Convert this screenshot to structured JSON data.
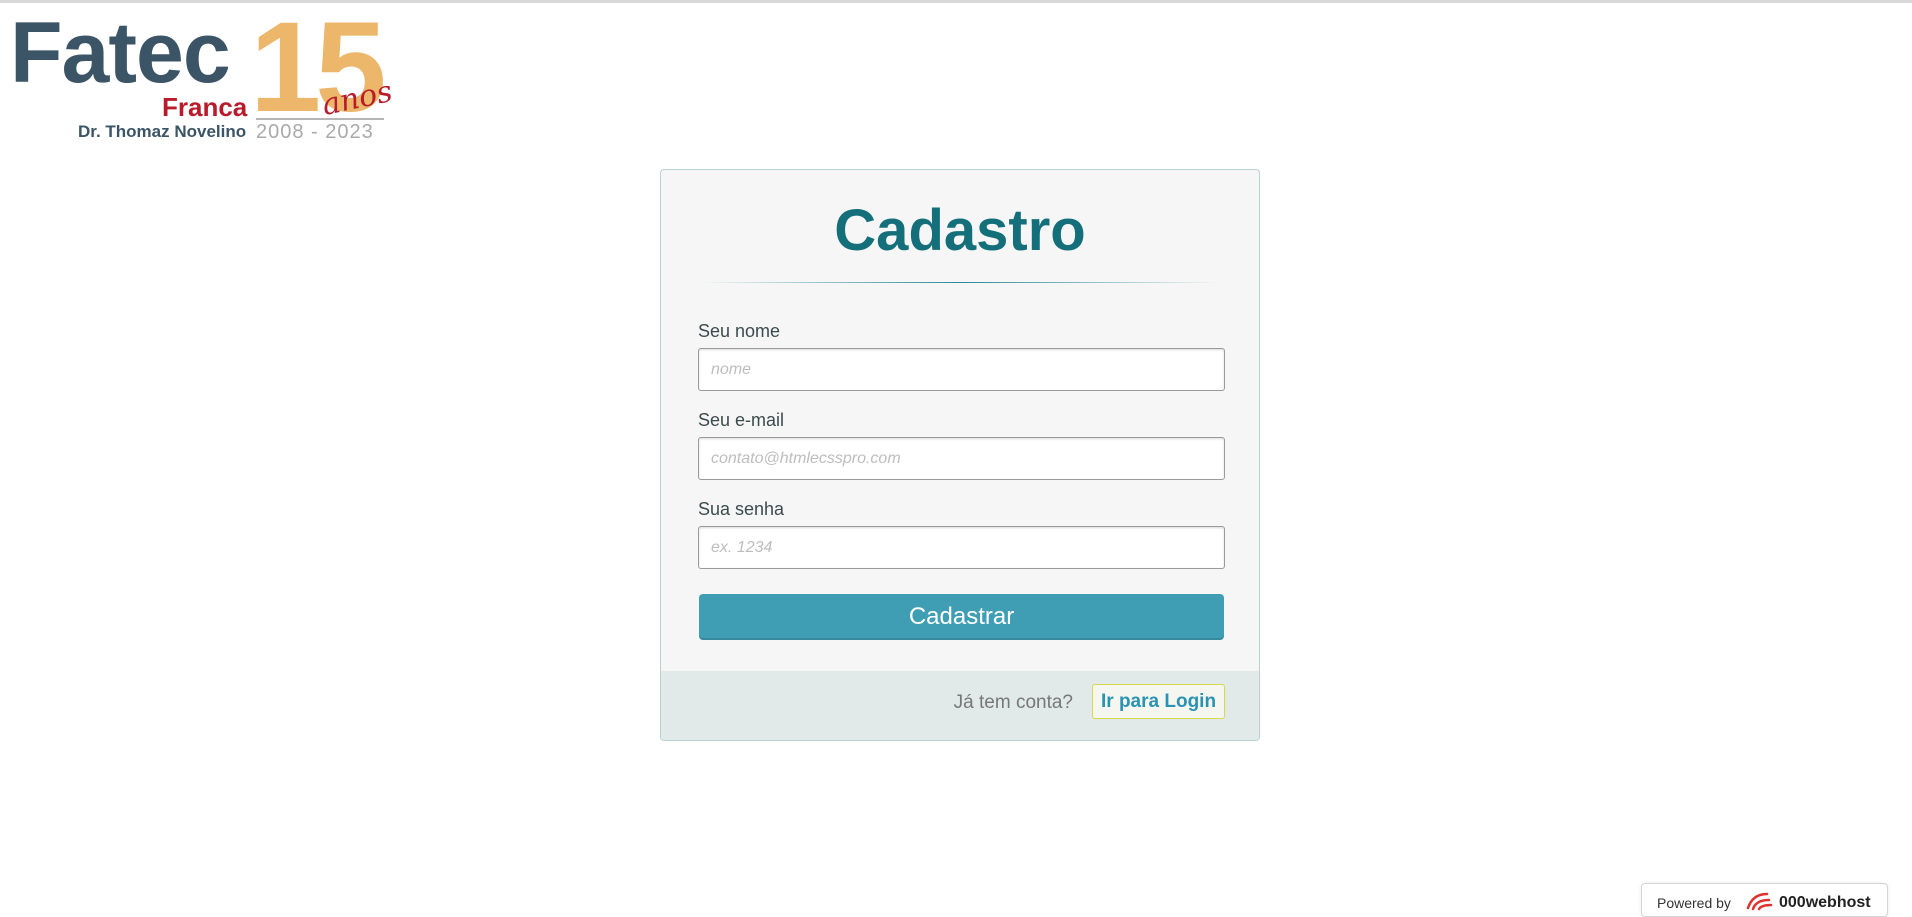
{
  "logo": {
    "fatec": "Fatec",
    "fifteen": "15",
    "anos": "anos",
    "franca": "Franca",
    "dr": "Dr. Thomaz Novelino",
    "years": "2008 - 2023"
  },
  "card": {
    "title": "Cadastro",
    "fields": [
      {
        "label": "Seu nome",
        "placeholder": "nome",
        "value": ""
      },
      {
        "label": "Seu e-mail",
        "placeholder": "contato@htmlecsspro.com",
        "value": ""
      },
      {
        "label": "Sua senha",
        "placeholder": "ex. 1234",
        "value": ""
      }
    ],
    "submit_label": "Cadastrar",
    "footer": {
      "question": "Já tem conta?",
      "login_link": "Ir para Login"
    }
  },
  "powered": {
    "text": "Powered by",
    "brand": "000webhost",
    "icon": "webhost-logo-icon"
  },
  "colors": {
    "title": "#146f7b",
    "button": "#3f9db4",
    "link": "#2a93b4",
    "logo_dark": "#3b5466",
    "logo_red": "#b81c2c",
    "logo_gold": "#ecb66b"
  }
}
